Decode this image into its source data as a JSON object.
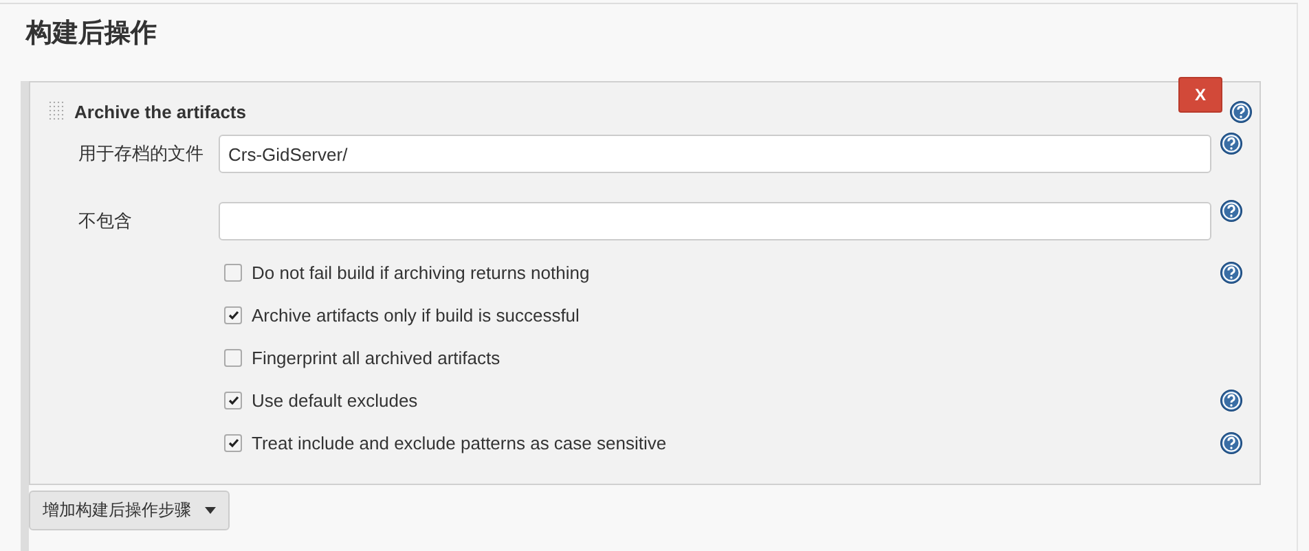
{
  "section_title": "构建后操作",
  "step": {
    "title": "Archive the artifacts",
    "delete_label": "X",
    "help": true,
    "fields": [
      {
        "label": "用于存档的文件",
        "value": "Crs-GidServer/",
        "help": true
      },
      {
        "label": "不包含",
        "help": true
      }
    ],
    "options": [
      {
        "label": "Do not fail build if archiving returns nothing",
        "checked": false,
        "help": true
      },
      {
        "label": "Archive artifacts only if build is successful",
        "checked": true,
        "help": false
      },
      {
        "label": "Fingerprint all archived artifacts",
        "checked": false,
        "help": false
      },
      {
        "label": "Use default excludes",
        "checked": true,
        "help": true
      },
      {
        "label": "Treat include and exclude patterns as case sensitive",
        "checked": true,
        "help": true
      }
    ]
  },
  "add_button": {
    "label": "增加构建后操作步骤"
  }
}
